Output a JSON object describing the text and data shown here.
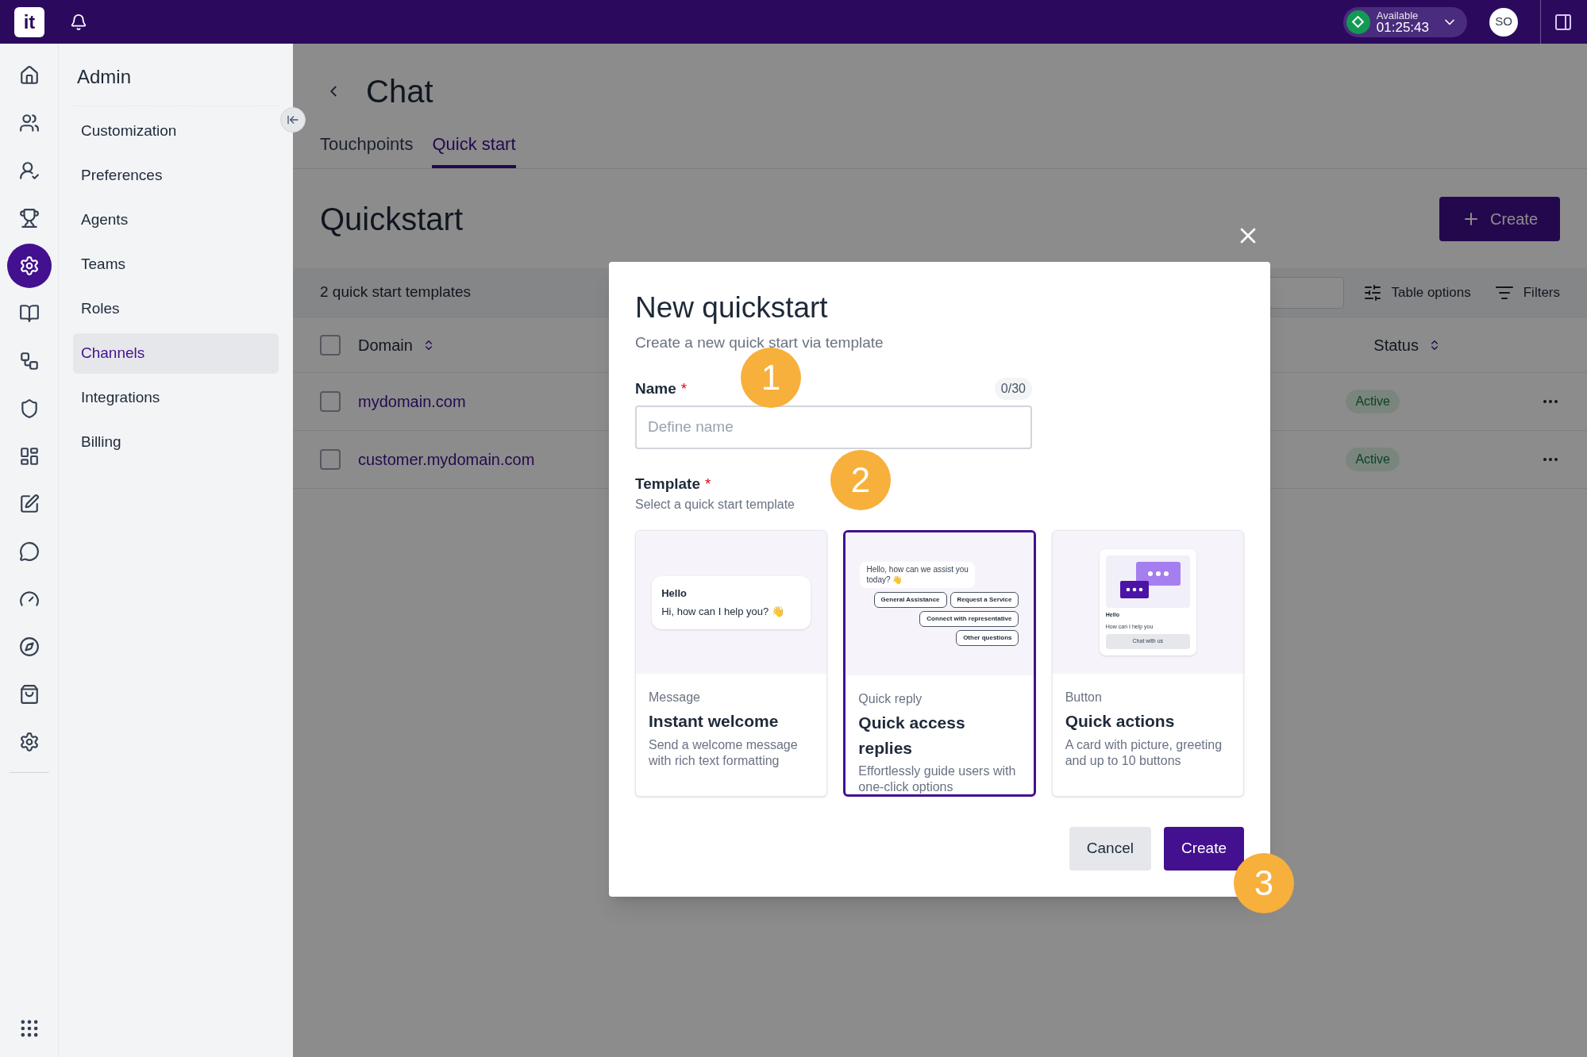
{
  "topbar": {
    "logo": "it",
    "status": {
      "label": "Available",
      "time": "01:25:43",
      "online": true
    },
    "avatar": "SO"
  },
  "rail": [
    {
      "selected": false
    },
    {
      "selected": false
    },
    {
      "selected": false
    },
    {
      "selected": false
    },
    {
      "selected": true
    },
    {
      "selected": false
    },
    {
      "selected": false
    },
    {
      "selected": false
    },
    {
      "selected": false
    },
    {
      "selected": false
    },
    {
      "selected": false
    },
    {
      "selected": false
    },
    {
      "selected": false
    },
    {
      "selected": false
    },
    {
      "selected": false
    }
  ],
  "sidebar": {
    "title": "Admin",
    "items": [
      {
        "label": "Customization",
        "selected": false
      },
      {
        "label": "Preferences",
        "selected": false
      },
      {
        "label": "Agents",
        "selected": false
      },
      {
        "label": "Teams",
        "selected": false
      },
      {
        "label": "Roles",
        "selected": false
      },
      {
        "label": "Channels",
        "selected": true
      },
      {
        "label": "Integrations",
        "selected": false
      },
      {
        "label": "Billing",
        "selected": false
      }
    ]
  },
  "page": {
    "title": "Chat",
    "tabs": [
      {
        "label": "Touchpoints",
        "selected": false
      },
      {
        "label": "Quick start",
        "selected": true
      }
    ],
    "heading": "Quickstart",
    "create_button": "Create",
    "toolbar": {
      "count": "2 quick start templates",
      "table_options": "Table options",
      "filters": "Filters"
    },
    "table": {
      "all_checked": false,
      "columns": [
        "Domain",
        "Status"
      ],
      "rows": [
        {
          "domain": "mydomain.com",
          "status": "Active",
          "checked": false
        },
        {
          "domain": "customer.mydomain.com",
          "status": "Active",
          "checked": false
        }
      ]
    }
  },
  "modal": {
    "title": "New quickstart",
    "subtitle": "Create a new quick start via template",
    "name": {
      "label": "Name",
      "required_mark": "*",
      "counter": "0/30",
      "placeholder": "Define name"
    },
    "template": {
      "label": "Template",
      "required_mark": "*",
      "hint": "Select a quick start template"
    },
    "cards": [
      {
        "kind": "message",
        "type": "Message",
        "title": "Instant welcome",
        "description": "Send a welcome message with rich text formatting",
        "selected": false,
        "preview": {
          "heading": "Hello",
          "text": "Hi, how can I help you? 👋"
        }
      },
      {
        "kind": "quick_reply",
        "type": "Quick reply",
        "title": "Quick access replies",
        "description": "Effortlessly guide users with one-click options",
        "selected": true,
        "preview": {
          "text": "Hello, how can we assist you today? 👋",
          "options": [
            "General Assistance",
            "Request a Service",
            "Connect with representative",
            "Other questions"
          ]
        }
      },
      {
        "kind": "button",
        "type": "Button",
        "title": "Quick actions",
        "description": "A card with picture, greeting and up to 10 buttons",
        "selected": false,
        "preview": {
          "heading": "Hello",
          "text": "How can I help you",
          "button": "Chat with us"
        }
      }
    ],
    "buttons": {
      "cancel": "Cancel",
      "create": "Create"
    },
    "callouts": [
      "1",
      "2",
      "3"
    ]
  }
}
